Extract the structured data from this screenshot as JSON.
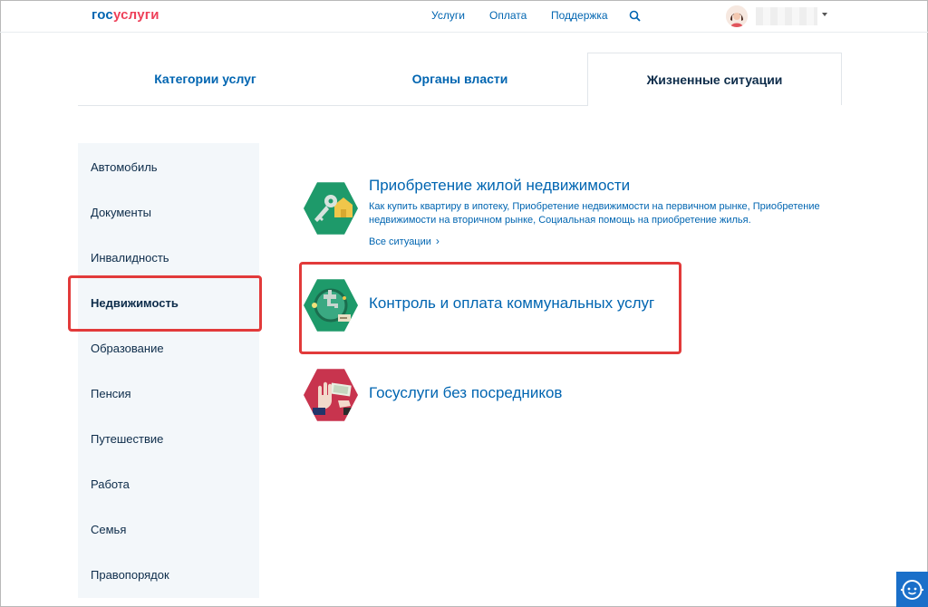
{
  "logo": {
    "part1": "гос",
    "part2": "услуги"
  },
  "topnav": {
    "services": "Услуги",
    "payment": "Оплата",
    "support": "Поддержка"
  },
  "tabs": [
    {
      "label": "Категории услуг"
    },
    {
      "label": "Органы власти"
    },
    {
      "label": "Жизненные ситуации"
    }
  ],
  "sidebar": {
    "items": [
      {
        "label": "Автомобиль"
      },
      {
        "label": "Документы"
      },
      {
        "label": "Инвалидность"
      },
      {
        "label": "Недвижимость"
      },
      {
        "label": "Образование"
      },
      {
        "label": "Пенсия"
      },
      {
        "label": "Путешествие"
      },
      {
        "label": "Работа"
      },
      {
        "label": "Семья"
      },
      {
        "label": "Правопорядок"
      }
    ],
    "active": "Недвижимость"
  },
  "situations": [
    {
      "title": "Приобретение жилой недвижимости",
      "description": "Как купить квартиру в ипотеку, Приобретение недвижимости на первичном рынке, Приобретение недвижимости на вторичном рынке, Социальная помощь на приобретение жилья.",
      "link": "Все ситуации",
      "icon": "key-house-icon",
      "color": "#1e9a6a"
    },
    {
      "title": "Контроль и оплата коммунальных услуг",
      "icon": "utility-tap-icon",
      "color": "#1e9a6a"
    },
    {
      "title": "Госуслуги без посредников",
      "icon": "hand-refuse-money-icon",
      "color": "#c8344e"
    }
  ],
  "colors": {
    "accent": "#0065b1",
    "brand_red": "#ee3f58",
    "highlight": "#e23a3a",
    "sidebar_bg": "#f3f7fa"
  }
}
